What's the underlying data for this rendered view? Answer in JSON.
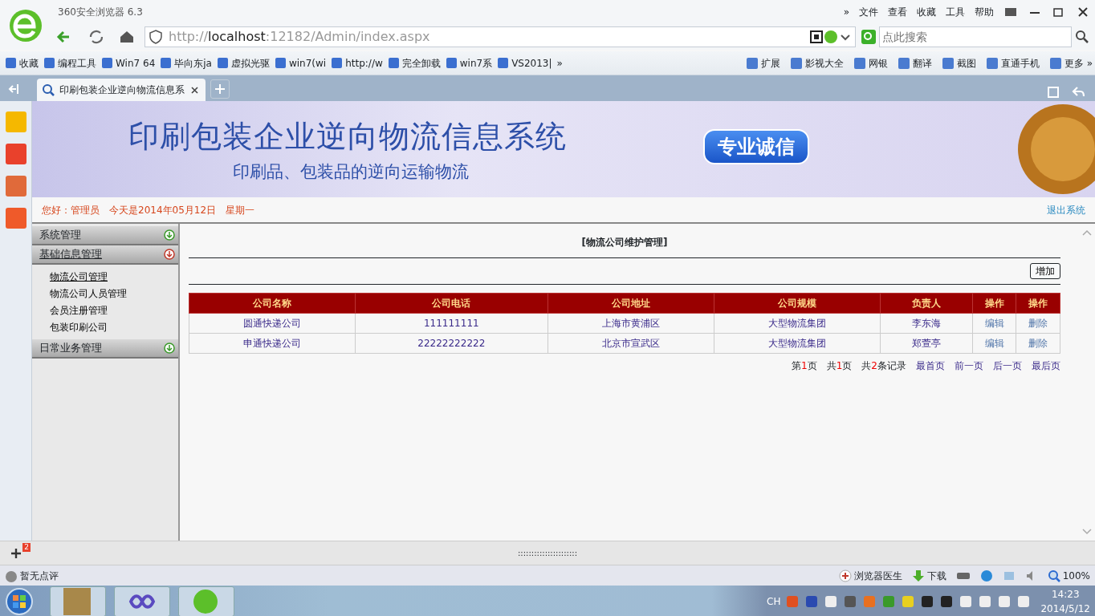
{
  "browser": {
    "title": "360安全浏览器 6.3",
    "menu": [
      "»",
      "文件",
      "查看",
      "收藏",
      "工具",
      "帮助"
    ],
    "url": {
      "scheme": "http://",
      "host": "localhost",
      "path": ":12182/Admin/index.aspx"
    },
    "search": {
      "placeholder": "点此搜索"
    }
  },
  "bookmarks": [
    "收藏",
    "编程工具",
    "Win7 64",
    "毕向东ja",
    "虚拟光驱",
    "win7(wi",
    "http://w",
    "完全卸载",
    "win7系",
    "VS2013|",
    "»"
  ],
  "tools": [
    "扩展",
    "影视大全",
    "网银",
    "翻译",
    "截图",
    "直通手机",
    "更多 »"
  ],
  "tabs": [
    {
      "label": "印刷包装企业逆向物流信息系",
      "selected": true
    }
  ],
  "dock": {
    "badge": "2"
  },
  "banner": {
    "title": "印刷包装企业逆向物流信息系统",
    "subtitle": "印刷品、包装品的逆向运输物流",
    "motto": "专业诚信"
  },
  "header": {
    "greeting": "您好：管理员",
    "date": "今天是2014年05月12日",
    "weekday": "星期一",
    "logout": "退出系统"
  },
  "menu": [
    {
      "label": "系统管理",
      "expanded": false
    },
    {
      "label": "基础信息管理",
      "expanded": true,
      "items": [
        "物流公司管理",
        "物流公司人员管理",
        "会员注册管理",
        "包装印刷公司"
      ]
    },
    {
      "label": "日常业务管理",
      "expanded": false
    }
  ],
  "content": {
    "title": "[物流公司维护管理]",
    "add_button": "增加",
    "table": {
      "columns": [
        "公司名称",
        "公司电话",
        "公司地址",
        "公司规模",
        "负责人",
        "操作",
        "操作"
      ],
      "rows": [
        [
          "圆通快递公司",
          "111111111",
          "上海市黄浦区",
          "大型物流集团",
          "李东海",
          "编辑",
          "删除"
        ],
        [
          "申通快递公司",
          "22222222222",
          "北京市宣武区",
          "大型物流集团",
          "郑萱亭",
          "编辑",
          "删除"
        ]
      ]
    },
    "pager": {
      "counts": [
        {
          "before": "第",
          "number": "1",
          "after": "页"
        },
        {
          "before": "共",
          "number": "1",
          "after": "页"
        },
        {
          "before": "共",
          "number": "2",
          "after": "条记录"
        }
      ],
      "links": [
        "最首页",
        "前一页",
        "后一页",
        "最后页"
      ]
    }
  },
  "splitter": "::::::::::::::::::::::",
  "status_bar": {
    "left": "暂无点评",
    "doctor": "浏览器医生",
    "download": "下载",
    "zoom": "100%"
  },
  "taskbar": {
    "language": "CH",
    "time": "14:23",
    "date": "2014/5/12"
  }
}
